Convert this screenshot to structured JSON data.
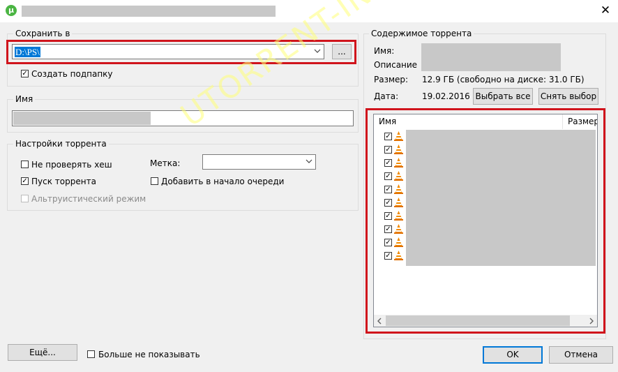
{
  "window": {
    "title": "",
    "close_glyph": "✕",
    "app_icon_letter": "µ"
  },
  "save_in": {
    "legend": "Сохранить в",
    "path_value": "D:\\PS\\",
    "browse_label": "...",
    "create_subfolder_label": "Создать подпапку",
    "create_subfolder_checked": true
  },
  "name_group": {
    "legend": "Имя",
    "value": ""
  },
  "torrent_settings": {
    "legend": "Настройки торрента",
    "skip_hash_label": "Не проверять хеш",
    "skip_hash_checked": false,
    "start_torrent_label": "Пуск торрента",
    "start_torrent_checked": true,
    "altruistic_label": "Альтруистический режим",
    "altruistic_checked": false,
    "label_caption": "Метка:",
    "label_value": "",
    "add_to_top_label": "Добавить в начало очереди",
    "add_to_top_checked": false
  },
  "torrent_contents": {
    "legend": "Содержимое торрента",
    "name_caption": "Имя:",
    "description_caption": "Описание",
    "size_caption": "Размер:",
    "size_value": "12.9 ГБ (свободно на диске: 31.0 ГБ)",
    "date_caption": "Дата:",
    "date_value": "19.02.2016",
    "select_all_label": "Выбрать все",
    "deselect_label": "Снять выбор",
    "columns": [
      "Имя",
      "Размер"
    ],
    "file_count": 10
  },
  "bottom": {
    "more_label": "Ещё...",
    "dont_show_label": "Больше не показывать",
    "dont_show_checked": false,
    "ok_label": "OK",
    "cancel_label": "Отмена"
  },
  "watermark": "UTORRENT-INFO",
  "colors": {
    "highlight_red": "#d0141c",
    "selection_blue": "#0078d7",
    "app_green": "#4bb543"
  }
}
